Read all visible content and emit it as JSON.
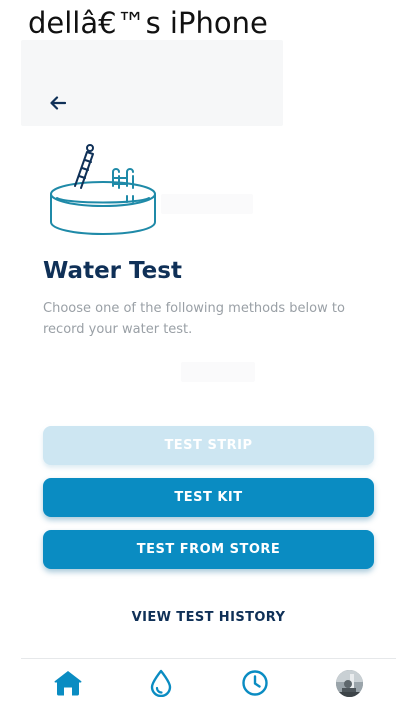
{
  "window": {
    "title": "dellâ€™s iPhone"
  },
  "header": {
    "back_icon": "arrow-left-icon"
  },
  "illustration": {
    "icon": "pool-icon"
  },
  "page": {
    "title": "Water Test",
    "description": "Choose one of the following methods below to record your water test."
  },
  "actions": {
    "test_strip_label": "TEST STRIP",
    "test_kit_label": "TEST KIT",
    "test_from_store_label": "TEST FROM STORE",
    "view_history_label": "VIEW TEST HISTORY"
  },
  "tabbar": {
    "items": [
      {
        "icon": "home-icon",
        "active": true
      },
      {
        "icon": "water-drop-icon",
        "active": false
      },
      {
        "icon": "clock-icon",
        "active": false
      },
      {
        "icon": "avatar",
        "active": false
      }
    ]
  },
  "colors": {
    "primary": "#0a8cc2",
    "primary_disabled": "#cde6f2",
    "navy": "#0f3057",
    "muted_text": "#9aa0a6",
    "illustration_teal": "#1f8aa8"
  }
}
